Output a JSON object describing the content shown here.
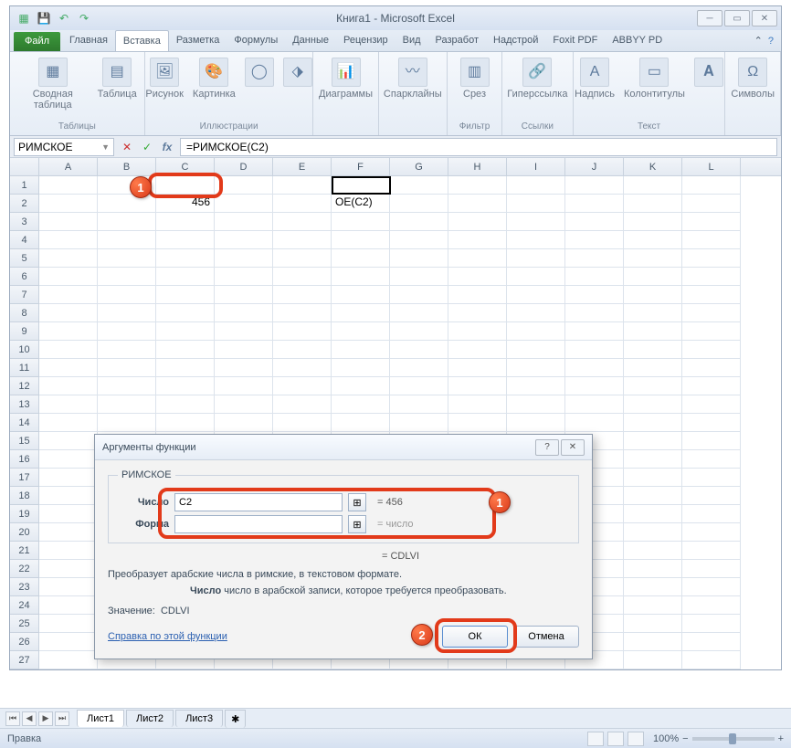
{
  "window": {
    "title": "Книга1 - Microsoft Excel"
  },
  "tabs": {
    "file": "Файл",
    "items": [
      "Главная",
      "Вставка",
      "Разметка",
      "Формулы",
      "Данные",
      "Рецензир",
      "Вид",
      "Разработ",
      "Надстрой",
      "Foxit PDF",
      "ABBYY PD"
    ],
    "active_index": 1
  },
  "ribbon": {
    "groups": [
      {
        "label": "Таблицы",
        "items": [
          "Сводная\nтаблица",
          "Таблица"
        ]
      },
      {
        "label": "Иллюстрации",
        "items": [
          "Рисунок",
          "Картинка",
          "",
          ""
        ]
      },
      {
        "label": "",
        "items": [
          "Диаграммы"
        ]
      },
      {
        "label": "",
        "items": [
          "Спарклайны"
        ]
      },
      {
        "label": "Фильтр",
        "items": [
          "Срез"
        ]
      },
      {
        "label": "Ссылки",
        "items": [
          "Гиперссылка"
        ]
      },
      {
        "label": "Текст",
        "items": [
          "Надпись",
          "Колонтитулы",
          ""
        ]
      },
      {
        "label": "",
        "items": [
          "Символы"
        ]
      }
    ]
  },
  "namebox": "РИМСКОЕ",
  "formula": "=РИМСКОЕ(C2)",
  "columns": [
    "A",
    "B",
    "C",
    "D",
    "E",
    "F",
    "G",
    "H",
    "I",
    "J",
    "K",
    "L"
  ],
  "row_count": 27,
  "cells": {
    "C2": "456",
    "F2": "ОЕ(C2)"
  },
  "dialog": {
    "title": "Аргументы функции",
    "fn_name": "РИМСКОЕ",
    "arg1_label": "Число",
    "arg1_value": "C2",
    "arg1_result": "= 456",
    "arg2_label": "Форма",
    "arg2_value": "",
    "arg2_result": "= число",
    "preview": "= CDLVI",
    "desc": "Преобразует арабские числа в римские, в текстовом формате.",
    "desc2_lbl": "Число",
    "desc2": " число в арабской записи, которое требуется преобразовать.",
    "value_label": "Значение:",
    "value": "CDLVI",
    "help": "Справка по этой функции",
    "ok": "ОК",
    "cancel": "Отмена"
  },
  "sheets": [
    "Лист1",
    "Лист2",
    "Лист3"
  ],
  "status": {
    "mode": "Правка",
    "zoom": "100%"
  },
  "callouts": {
    "c1": "1",
    "c2": "1",
    "c3": "2"
  }
}
